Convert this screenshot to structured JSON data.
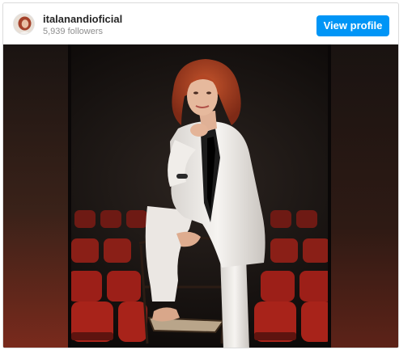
{
  "profile": {
    "username": "italanandioficial",
    "followers": "5,939 followers",
    "avatar_icon": "profile-avatar"
  },
  "actions": {
    "view_profile_label": "View profile"
  },
  "colors": {
    "button_blue": "#0095f6",
    "username": "#262626",
    "muted": "#8e8e8e",
    "seat_red": "#9c1f18"
  }
}
